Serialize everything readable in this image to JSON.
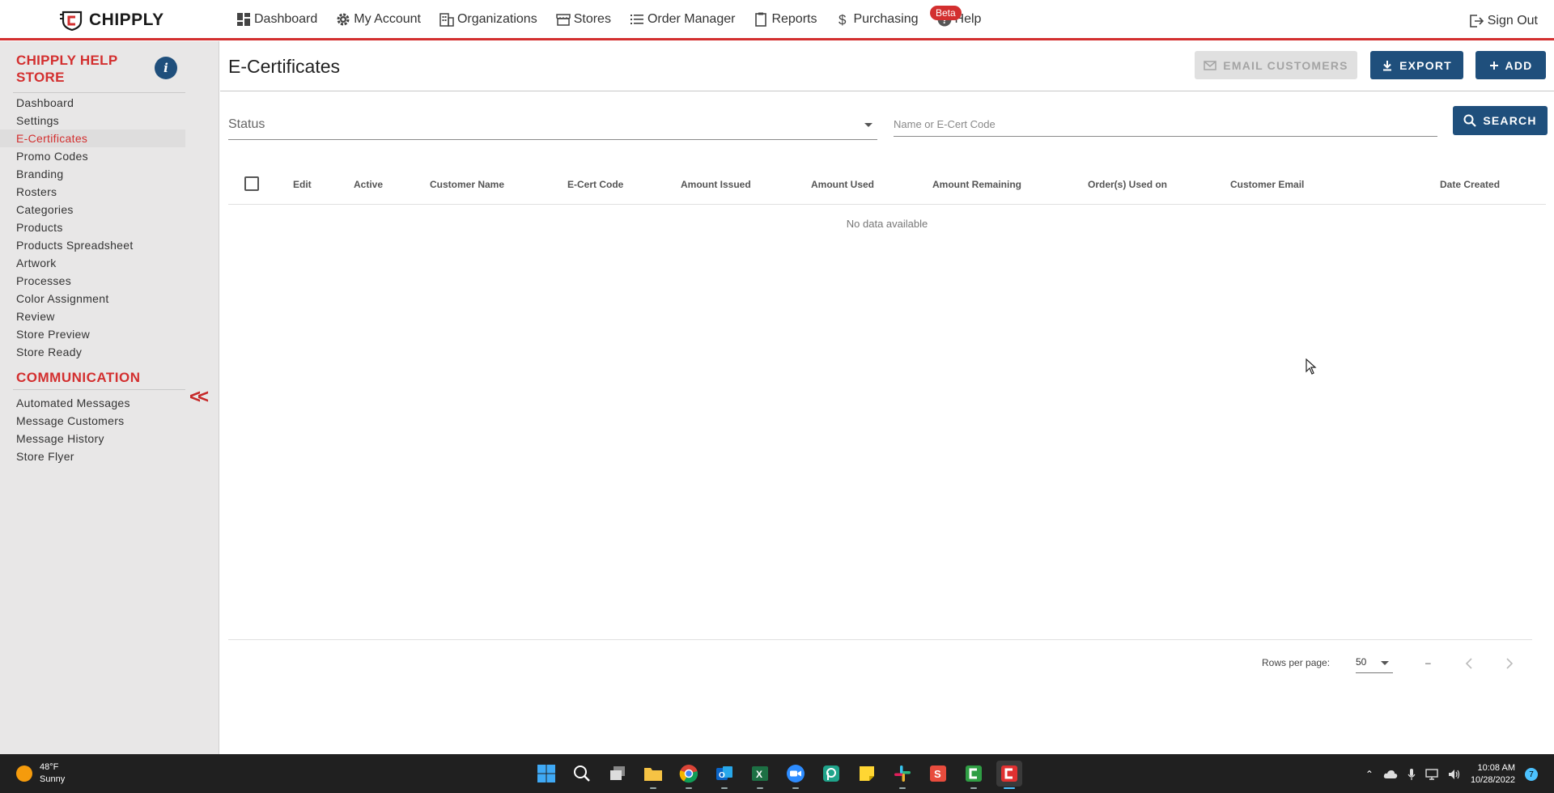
{
  "brand": {
    "name": "CHIPPLY"
  },
  "nav": {
    "items": [
      {
        "label": "Dashboard",
        "icon": "dashboard-icon"
      },
      {
        "label": "My Account",
        "icon": "gear-icon"
      },
      {
        "label": "Organizations",
        "icon": "building-icon"
      },
      {
        "label": "Stores",
        "icon": "store-icon"
      },
      {
        "label": "Order Manager",
        "icon": "list-icon"
      },
      {
        "label": "Reports",
        "icon": "clipboard-icon"
      },
      {
        "label": "Purchasing",
        "icon": "dollar-icon"
      },
      {
        "label": "Help",
        "icon": "help-icon"
      }
    ],
    "beta_badge": "Beta",
    "sign_out": "Sign Out"
  },
  "sidebar": {
    "store_title": "CHIPPLY HELP STORE",
    "info_label": "i",
    "store_items": [
      "Dashboard",
      "Settings",
      "E-Certificates",
      "Promo Codes",
      "Branding",
      "Rosters",
      "Categories",
      "Products",
      "Products Spreadsheet",
      "Artwork",
      "Processes",
      "Color Assignment",
      "Review",
      "Store Preview",
      "Store Ready"
    ],
    "active_item": "E-Certificates",
    "communication_title": "COMMUNICATION",
    "communication_items": [
      "Automated Messages",
      "Message Customers",
      "Message History",
      "Store Flyer"
    ],
    "collapse_label": "<<"
  },
  "page": {
    "title": "E-Certificates",
    "buttons": {
      "email_customers": "EMAIL CUSTOMERS",
      "export": "EXPORT",
      "add": "ADD",
      "search": "SEARCH"
    },
    "filters": {
      "status_label": "Status",
      "search_placeholder": "Name or E-Cert Code"
    },
    "table": {
      "columns": [
        "Edit",
        "Active",
        "Customer Name",
        "E-Cert Code",
        "Amount Issued",
        "Amount Used",
        "Amount Remaining",
        "Order(s) Used on",
        "Customer Email",
        "Date Created"
      ],
      "rows": [],
      "empty_message": "No data available"
    },
    "pagination": {
      "rows_per_page_label": "Rows per page:",
      "rows_per_page": "50",
      "range": "–"
    }
  },
  "taskbar": {
    "weather": {
      "temp": "48°F",
      "condition": "Sunny"
    },
    "apps": [
      "windows-start-icon",
      "search-icon",
      "task-view-icon",
      "file-explorer-icon",
      "chrome-icon",
      "outlook-icon",
      "excel-icon",
      "zoom-icon",
      "app-icon",
      "sticky-notes-icon",
      "slack-icon",
      "snagit-icon",
      "chipply-green-icon",
      "chipply-red-icon"
    ],
    "time": "10:08 AM",
    "date": "10/28/2022",
    "notifications": "7"
  },
  "colors": {
    "brand_red": "#d32f2f",
    "primary_blue": "#1f4f7c",
    "sidebar_bg": "#e8e7e7"
  }
}
